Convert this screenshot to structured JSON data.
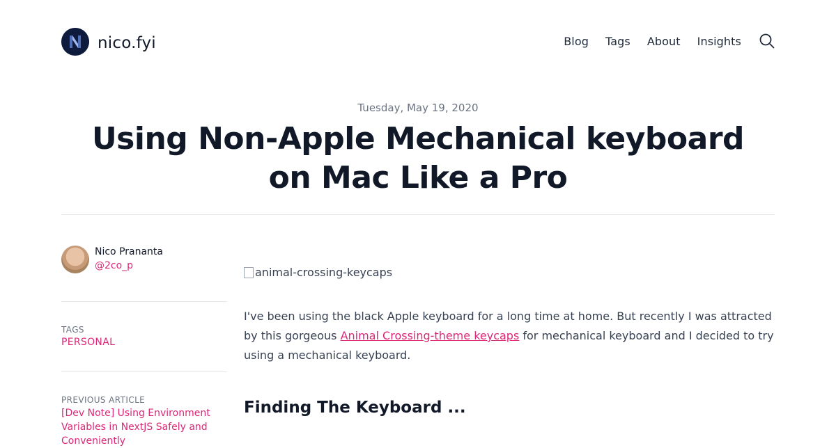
{
  "site": {
    "brand": "nico.fyi",
    "nav": [
      "Blog",
      "Tags",
      "About",
      "Insights"
    ]
  },
  "post": {
    "date": "Tuesday, May 19, 2020",
    "title": "Using Non-Apple Mechanical keyboard on Mac Like a Pro",
    "image_alt": "animal-crossing-keycaps",
    "paragraph": {
      "before_link": "I've been using the black Apple keyboard for a long time at home. But recently I was attracted by this gorgeous ",
      "link_text": "Animal Crossing-theme keycaps",
      "after_link": " for mechanical keyboard and I decided to try using a mechanical keyboard."
    },
    "heading": "Finding The Keyboard ..."
  },
  "author": {
    "name": "Nico Prananta",
    "handle": "@2co_p"
  },
  "sidebar": {
    "tags_label": "TAGS",
    "tag": "PERSONAL",
    "prev_label": "PREVIOUS ARTICLE",
    "prev_title": "[Dev Note] Using Environment Variables in NextJS Safely and Conveniently"
  },
  "colors": {
    "accent": "#db2777",
    "text": "#111827",
    "muted": "#6b7280"
  },
  "icons": {
    "search": "search-icon",
    "logo": "logo-n-icon"
  }
}
